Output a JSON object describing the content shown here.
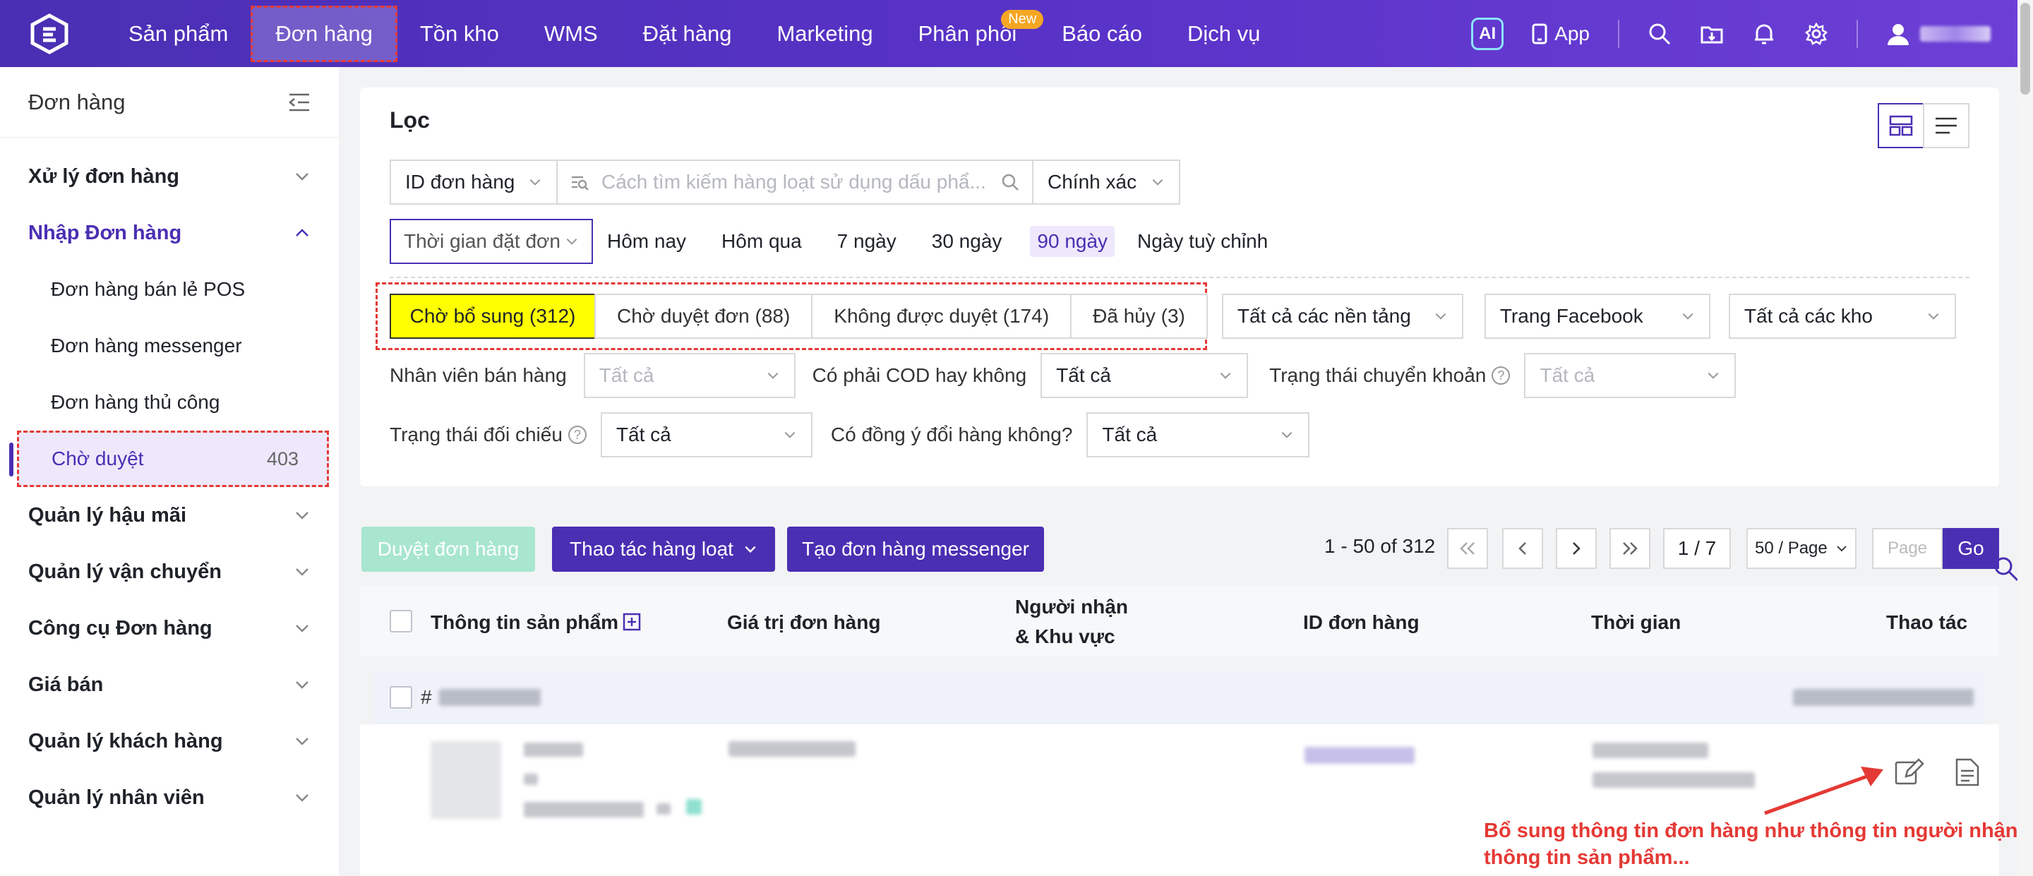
{
  "topnav": {
    "items": [
      {
        "label": "Sản phẩm"
      },
      {
        "label": "Đơn hàng",
        "active": true
      },
      {
        "label": "Tồn kho"
      },
      {
        "label": "WMS"
      },
      {
        "label": "Đặt hàng"
      },
      {
        "label": "Marketing"
      },
      {
        "label": "Phân phối",
        "badge": "New"
      },
      {
        "label": "Báo cáo"
      },
      {
        "label": "Dịch vụ"
      }
    ],
    "ai_label": "AI",
    "app_label": "App",
    "brand_color": "#5a33c9"
  },
  "sidebar": {
    "title": "Đơn hàng",
    "groups": [
      {
        "label": "Xử lý đơn hàng"
      },
      {
        "label": "Nhập Đơn hàng",
        "open": true,
        "children": [
          {
            "label": "Đơn hàng bán lẻ POS"
          },
          {
            "label": "Đơn hàng messenger"
          },
          {
            "label": "Đơn hàng thủ công"
          },
          {
            "label": "Chờ duyệt",
            "count": "403",
            "active": true
          }
        ]
      },
      {
        "label": "Quản lý hậu mãi"
      },
      {
        "label": "Quản lý vận chuyển"
      },
      {
        "label": "Công cụ Đơn hàng"
      },
      {
        "label": "Giá bán"
      },
      {
        "label": "Quản lý khách hàng"
      },
      {
        "label": "Quản lý nhân viên"
      }
    ]
  },
  "filter": {
    "title": "Lọc",
    "id_type": "ID đơn hàng",
    "search_placeholder": "Cách tìm kiếm hàng loạt sử dụng dấu phẩ...",
    "match_mode": "Chính xác",
    "date_type": "Thời gian đặt đơn",
    "date_chips": [
      {
        "label": "Hôm nay"
      },
      {
        "label": "Hôm qua"
      },
      {
        "label": "7 ngày"
      },
      {
        "label": "30 ngày"
      },
      {
        "label": "90 ngày",
        "active": true
      },
      {
        "label": "Ngày tuỳ chỉnh"
      }
    ],
    "status_tabs": [
      {
        "label": "Chờ bổ sung (312)",
        "active": true
      },
      {
        "label": "Chờ duyệt đơn (88)"
      },
      {
        "label": "Không được duyệt (174)"
      },
      {
        "label": "Đã hủy (3)"
      }
    ],
    "platform": "Tất cả các nền tảng",
    "store": "Trang Facebook",
    "warehouse": "Tất cả các kho",
    "salesperson_label": "Nhân viên bán hàng",
    "salesperson_value": "Tất cả",
    "cod_label": "Có phải COD hay không",
    "cod_value": "Tất cả",
    "transfer_label": "Trạng thái chuyển khoản",
    "transfer_value": "Tất cả",
    "reconcile_label": "Trạng thái đối chiếu",
    "reconcile_value": "Tất cả",
    "exchange_label": "Có đồng ý đổi hàng không?",
    "exchange_value": "Tất cả"
  },
  "actions": {
    "approve": "Duyệt đơn hàng",
    "bulk": "Thao tác hàng loạt",
    "create_messenger": "Tạo đơn hàng messenger"
  },
  "pagination": {
    "summary": "1 - 50 of 312",
    "page": "1 / 7",
    "page_size": "50 / Page",
    "goto_placeholder": "Page",
    "go": "Go"
  },
  "table": {
    "headers": {
      "product": "Thông tin sản phẩm",
      "value": "Giá trị đơn hàng",
      "receiver": "Người nhận",
      "region": "& Khu vực",
      "order_id": "ID đơn hàng",
      "time": "Thời gian",
      "actions": "Thao tác"
    },
    "order_prefix": "#"
  },
  "annotation": {
    "line1": "Bổ sung thông tin đơn hàng như thông tin người nhận,",
    "line2": "thông tin sản phẩm..."
  }
}
